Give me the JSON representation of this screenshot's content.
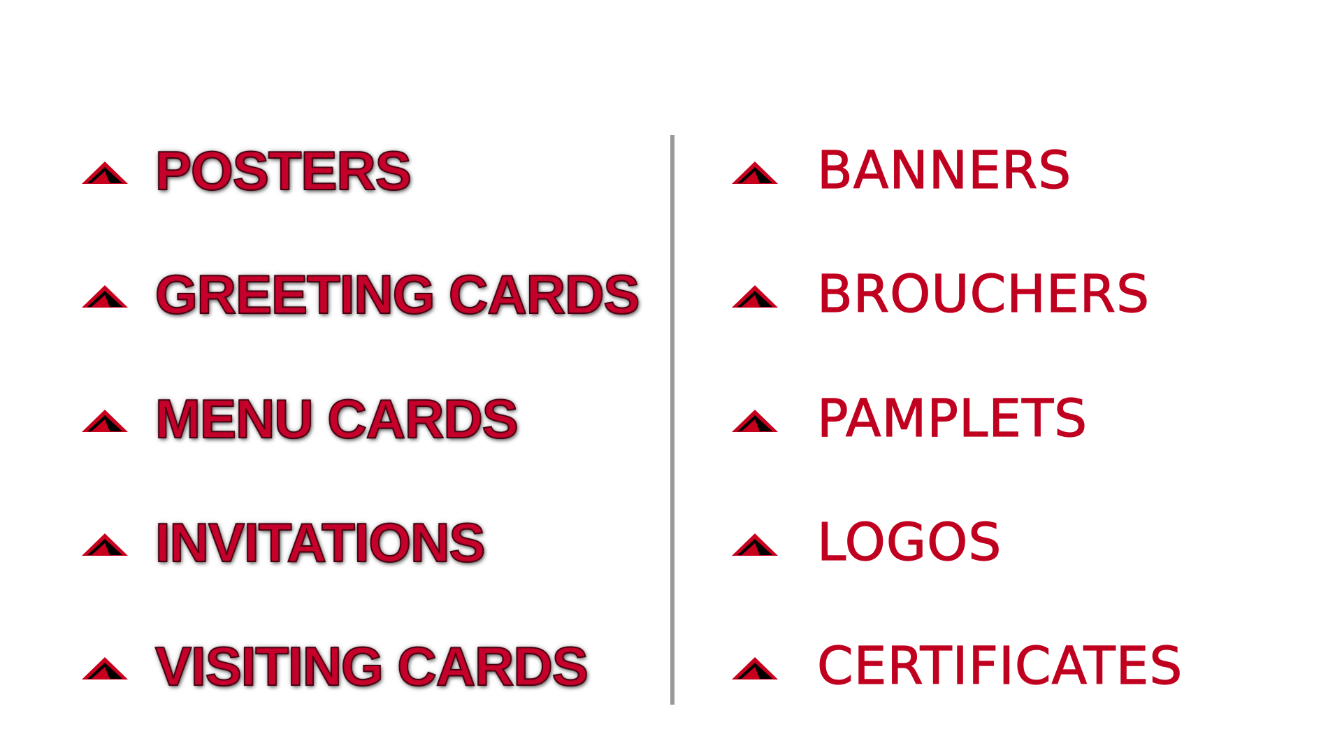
{
  "left_items": [
    {
      "label": "POSTERS"
    },
    {
      "label": "GREETING CARDS"
    },
    {
      "label": "MENU CARDS"
    },
    {
      "label": "INVITATIONS"
    },
    {
      "label": "VISITING CARDS"
    }
  ],
  "right_items": [
    {
      "label": "BANNERS"
    },
    {
      "label": "BROUCHERS"
    },
    {
      "label": "PAMPLETS"
    },
    {
      "label": "LOGOS"
    },
    {
      "label": "CERTIFICATES"
    }
  ],
  "bullet_icon": "red-black-triangle-icon",
  "colors": {
    "text": "#c0001f",
    "bullet_red": "#c8001e",
    "bullet_dark": "#000000",
    "divider": "#999999",
    "background": "#ffffff"
  }
}
